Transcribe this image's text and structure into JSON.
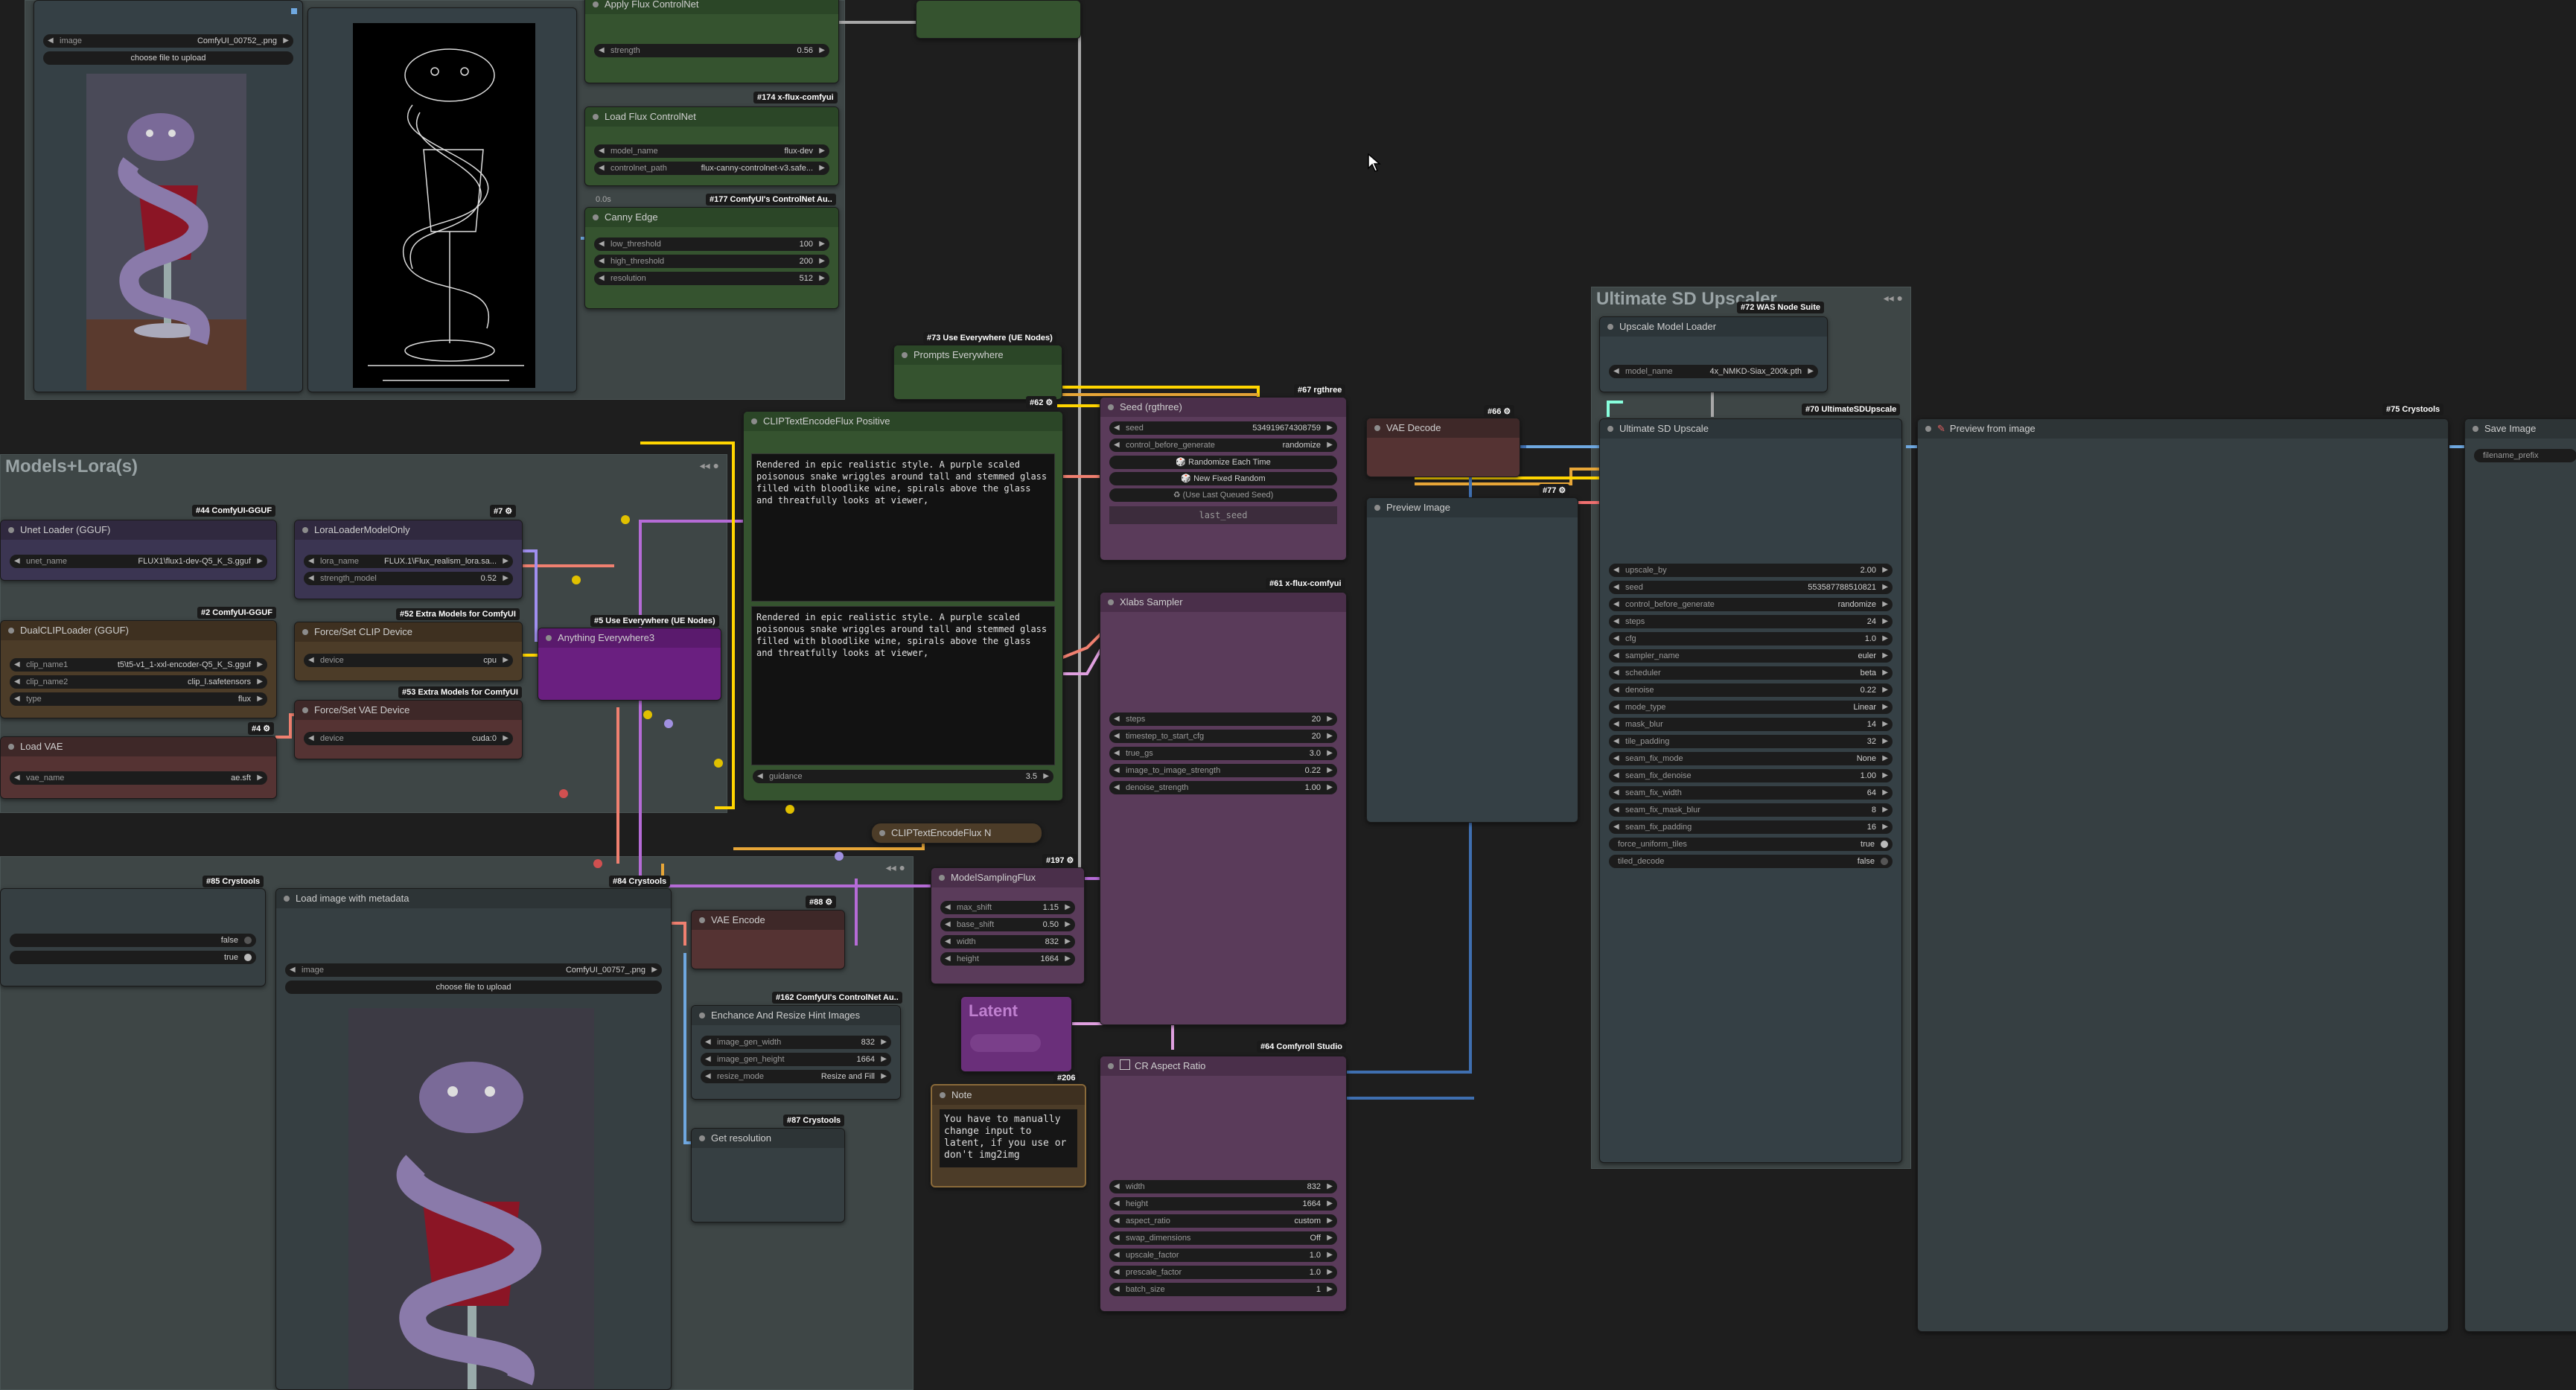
{
  "groups": {
    "models_loras": "Models+Lora(s)",
    "upscaler": "Ultimate SD Upscaler"
  },
  "tags": {
    "t174": "#174 x-flux-comfyui",
    "t177": "#177 ComfyUI's ControlNet Au..",
    "t73": "#73 Use Everywhere (UE Nodes)",
    "t62": "#62 ⚙",
    "t67": "#67 rgthree",
    "t66": "#66 ⚙",
    "t77": "#77 ⚙",
    "t61": "#61 x-flux-comfyui",
    "t44": "#44 ComfyUI-GGUF",
    "t7": "#7 ⚙",
    "t2": "#2 ComfyUI-GGUF",
    "t52": "#52 Extra Models for ComfyUI",
    "t5": "#5 Use Everywhere (UE Nodes)",
    "t53": "#53 Extra Models for ComfyUI",
    "t4": "#4 ⚙",
    "t85": "#85 Crystools",
    "t84": "#84 Crystools",
    "t88": "#88 ⚙",
    "t197": "#197 ⚙",
    "t162": "#162 ComfyUI's ControlNet Au..",
    "t87": "#87 Crystools",
    "t206": "#206",
    "t64": "#64 Comfyroll Studio",
    "t72": "#72 WAS Node Suite",
    "t70": "#70 UltimateSDUpscale",
    "t75": "#75 Crystools"
  },
  "load_image_top": {
    "image_label": "image",
    "image_value": "ComfyUI_00752_.png",
    "upload": "choose file to upload"
  },
  "apply_flux_controlnet": {
    "title": "Apply Flux ControlNet",
    "strength_label": "strength",
    "strength_value": "0.56"
  },
  "load_flux_controlnet": {
    "title": "Load Flux ControlNet",
    "model_name_label": "model_name",
    "model_name_value": "flux-dev",
    "controlnet_path_label": "controlnet_path",
    "controlnet_path_value": "flux-canny-controlnet-v3.safe..."
  },
  "canny_edge": {
    "title": "Canny Edge",
    "time": "0.0s",
    "low_label": "low_threshold",
    "low_value": "100",
    "high_label": "high_threshold",
    "high_value": "200",
    "res_label": "resolution",
    "res_value": "512"
  },
  "prompts_everywhere": {
    "title": "Prompts Everywhere"
  },
  "clip_positive": {
    "title": "CLIPTextEncodeFlux Positive",
    "text1": "Rendered in epic realistic style. A purple scaled poisonous snake wriggles around tall and stemmed glass filled with bloodlike wine, spirals above the glass and threatfully looks at viewer,",
    "text2": "Rendered in epic realistic style. A purple scaled poisonous snake wriggles around tall and stemmed glass filled with bloodlike wine, spirals above the glass and threatfully looks at viewer,",
    "guidance_label": "guidance",
    "guidance_value": "3.5"
  },
  "clip_negative": {
    "title": "CLIPTextEncodeFlux N"
  },
  "seed_node": {
    "title": "Seed (rgthree)",
    "seed_label": "seed",
    "seed_value": "534919674308759",
    "cbg_label": "control_before_generate",
    "cbg_value": "randomize",
    "btn_randomize": "🎲 Randomize Each Time",
    "btn_new_fixed": "🎲 New Fixed Random",
    "btn_last": "♻ (Use Last Queued Seed)",
    "last_seed": "last_seed"
  },
  "vae_decode_top": {
    "title": "VAE Decode"
  },
  "preview_image": {
    "title": "Preview Image"
  },
  "xlabs_sampler": {
    "title": "Xlabs Sampler",
    "steps_label": "steps",
    "steps_value": "20",
    "ts_label": "timestep_to_start_cfg",
    "ts_value": "20",
    "truegs_label": "true_gs",
    "truegs_value": "3.0",
    "i2i_label": "image_to_image_strength",
    "i2i_value": "0.22",
    "denoise_label": "denoise_strength",
    "denoise_value": "1.00"
  },
  "unet_loader": {
    "title": "Unet Loader (GGUF)",
    "unet_label": "unet_name",
    "unet_value": "FLUX1\\flux1-dev-Q5_K_S.gguf"
  },
  "lora_loader": {
    "title": "LoraLoaderModelOnly",
    "lora_label": "lora_name",
    "lora_value": "FLUX.1\\Flux_realism_lora.sa...",
    "strength_label": "strength_model",
    "strength_value": "0.52"
  },
  "dual_clip": {
    "title": "DualCLIPLoader (GGUF)",
    "clip1_label": "clip_name1",
    "clip1_value": "t5\\t5-v1_1-xxl-encoder-Q5_K_S.gguf",
    "clip2_label": "clip_name2",
    "clip2_value": "clip_l.safetensors",
    "type_label": "type",
    "type_value": "flux"
  },
  "force_clip": {
    "title": "Force/Set CLIP Device",
    "device_label": "device",
    "device_value": "cpu"
  },
  "anything_everywhere": {
    "title": "Anything Everywhere3"
  },
  "force_vae": {
    "title": "Force/Set VAE Device",
    "device_label": "device",
    "device_value": "cuda:0"
  },
  "load_vae": {
    "title": "Load VAE",
    "vae_label": "vae_name",
    "vae_value": "ae.sft"
  },
  "left_toggles": {
    "v1": "false",
    "v2": "true"
  },
  "load_meta": {
    "title": "Load image with metadata",
    "image_label": "image",
    "image_value": "ComfyUI_00757_.png",
    "upload": "choose file to upload"
  },
  "vae_encode": {
    "title": "VAE Encode"
  },
  "enhance_resize": {
    "title": "Enchance And Resize Hint Images",
    "w_label": "image_gen_width",
    "w_value": "832",
    "h_label": "image_gen_height",
    "h_value": "1664",
    "mode_label": "resize_mode",
    "mode_value": "Resize and Fill"
  },
  "get_resolution": {
    "title": "Get resolution"
  },
  "model_sampling": {
    "title": "ModelSamplingFlux",
    "ms_label": "max_shift",
    "ms_value": "1.15",
    "bs_label": "base_shift",
    "bs_value": "0.50",
    "w_label": "width",
    "w_value": "832",
    "h_label": "height",
    "h_value": "1664"
  },
  "latent": {
    "title": "Latent"
  },
  "note": {
    "title": "Note",
    "text": "You have to manually\nchange input to latent,\nif you use or don't\nimg2img"
  },
  "cr_aspect": {
    "title": "CR Aspect Ratio",
    "w_label": "width",
    "w_value": "832",
    "h_label": "height",
    "h_value": "1664",
    "ar_label": "aspect_ratio",
    "ar_value": "custom",
    "swap_label": "swap_dimensions",
    "swap_value": "Off",
    "uf_label": "upscale_factor",
    "uf_value": "1.0",
    "pf_label": "prescale_factor",
    "pf_value": "1.0",
    "bs_label": "batch_size",
    "bs_value": "1"
  },
  "upscale_model_loader": {
    "title": "Upscale Model Loader",
    "model_label": "model_name",
    "model_value": "4x_NMKD-Siax_200k.pth"
  },
  "ultimate_sd": {
    "title": "Ultimate SD Upscale",
    "rows": [
      [
        "upscale_by",
        "2.00"
      ],
      [
        "seed",
        "553587788510821"
      ],
      [
        "control_before_generate",
        "randomize"
      ],
      [
        "steps",
        "24"
      ],
      [
        "cfg",
        "1.0"
      ],
      [
        "sampler_name",
        "euler"
      ],
      [
        "scheduler",
        "beta"
      ],
      [
        "denoise",
        "0.22"
      ],
      [
        "mode_type",
        "Linear"
      ],
      [
        "mask_blur",
        "14"
      ],
      [
        "tile_padding",
        "32"
      ],
      [
        "seam_fix_mode",
        "None"
      ],
      [
        "seam_fix_denoise",
        "1.00"
      ],
      [
        "seam_fix_width",
        "64"
      ],
      [
        "seam_fix_mask_blur",
        "8"
      ],
      [
        "seam_fix_padding",
        "16"
      ]
    ],
    "force_label": "force_uniform_tiles",
    "force_value": "true",
    "tiled_label": "tiled_decode",
    "tiled_value": "false"
  },
  "preview_from_image": {
    "title": "Preview from image"
  },
  "save_image": {
    "title": "Save Image",
    "prefix": "filename_prefix"
  }
}
